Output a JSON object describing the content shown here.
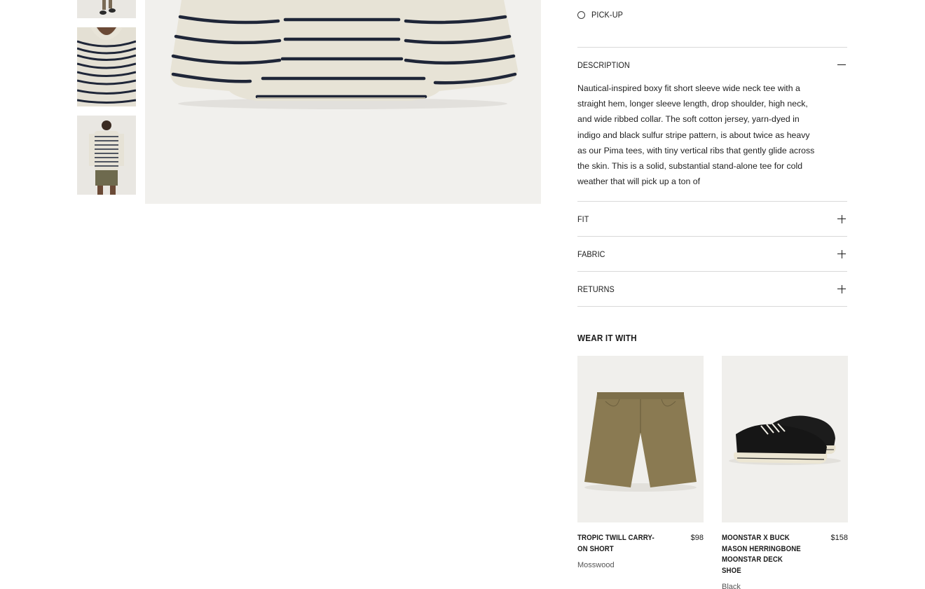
{
  "gallery": {
    "thumbnails": [
      {
        "name": "thumb-legs",
        "alt_icon": "product-thumbnail"
      },
      {
        "name": "thumb-collar",
        "alt_icon": "product-thumbnail"
      },
      {
        "name": "thumb-back",
        "alt_icon": "product-thumbnail"
      }
    ]
  },
  "fulfillment": {
    "pickup_label": "PICK-UP"
  },
  "accordions": {
    "description": {
      "title": "DESCRIPTION",
      "icon": "minus-icon",
      "body": "Nautical-inspired boxy fit short sleeve wide neck tee with a straight hem, longer sleeve length, drop shoulder, high neck, and wide ribbed collar. The soft cotton jersey, yarn-dyed in indigo and black sulfur stripe pattern, is about twice as heavy as our Pima tees, with tiny vertical ribs that gently glide across the skin. This is a solid, substantial stand-alone tee for cold weather that will pick up a ton of"
    },
    "fit": {
      "title": "FIT",
      "icon": "plus-icon"
    },
    "fabric": {
      "title": "FABRIC",
      "icon": "plus-icon"
    },
    "returns": {
      "title": "RETURNS",
      "icon": "plus-icon"
    }
  },
  "wear_it_with": {
    "title": "WEAR IT WITH",
    "products": [
      {
        "name": "TROPIC TWILL CARRY-ON SHORT",
        "price": "$98",
        "color": "Mosswood"
      },
      {
        "name": "MOONSTAR X BUCK MASON HERRINGBONE MOONSTAR DECK SHOE",
        "price": "$158",
        "color": "Black"
      }
    ]
  },
  "colors": {
    "divider": "#d9d9d9",
    "stripe": "#1f2638",
    "shirt": "#e7e3d6",
    "shorts": "#8a7a52",
    "shoe": "#1c1c1c"
  }
}
